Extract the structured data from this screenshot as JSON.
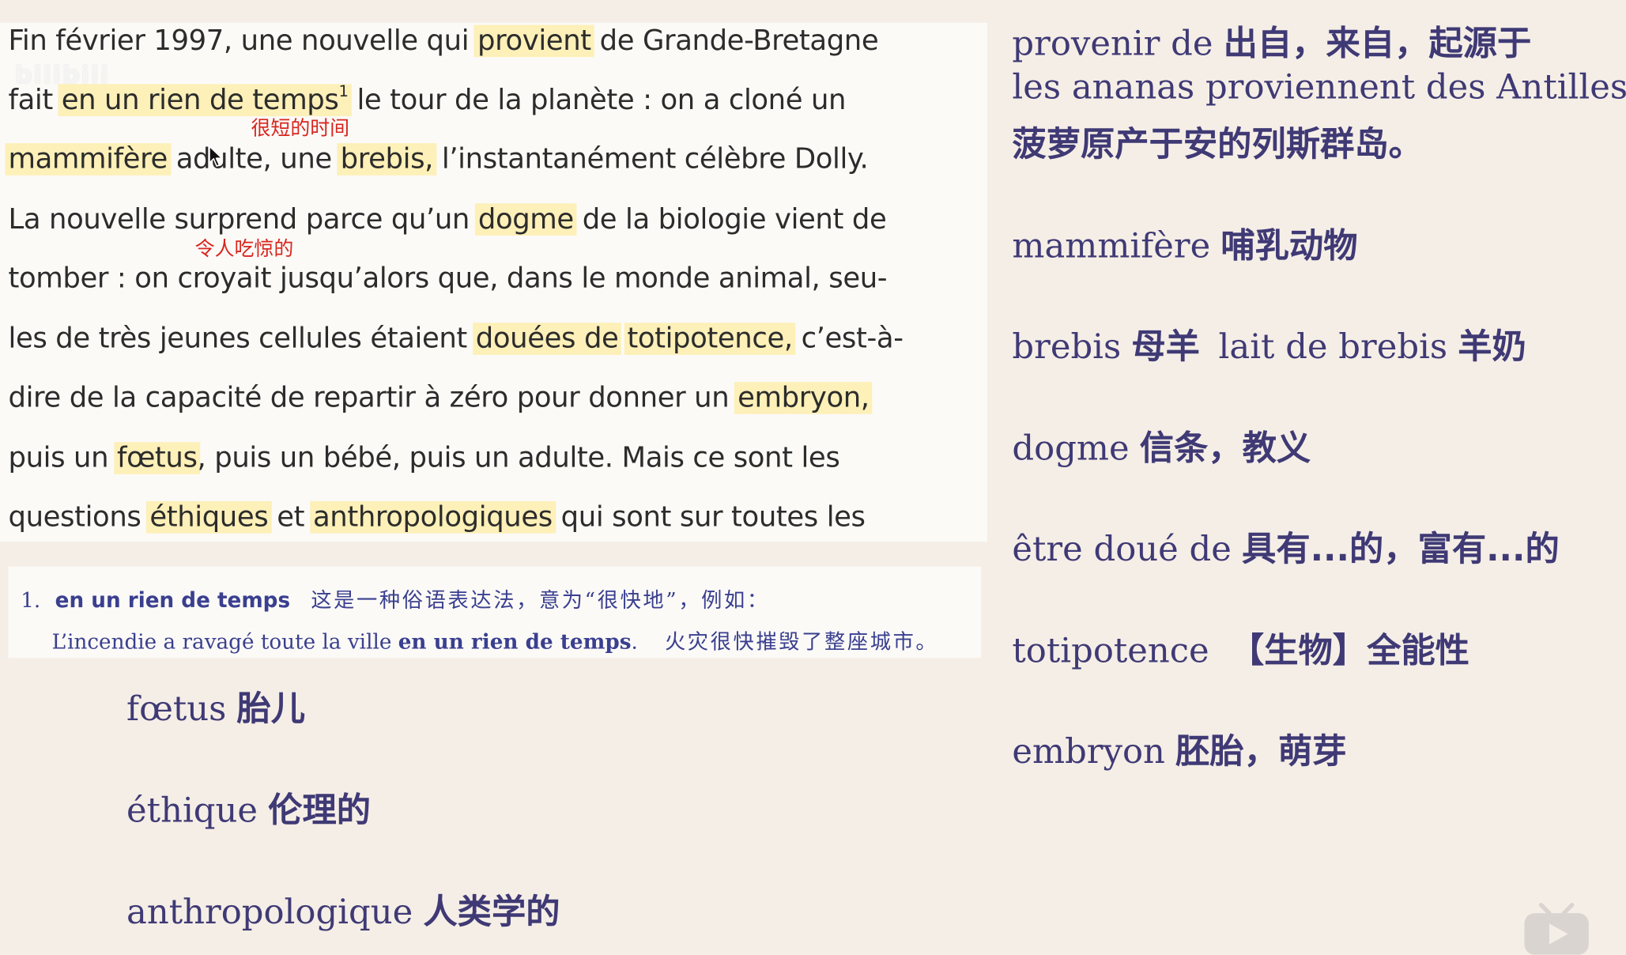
{
  "passage": {
    "lines": [
      {
        "t1": "Fin février 1997, une nouvelle qui ",
        "h1": "provient",
        "t2": " de Grande-Bretagne"
      },
      {
        "t1": "fait ",
        "h1": "en un rien de temps",
        "sup": "1",
        "t2": " le tour de la planète : on a cloné un"
      },
      {
        "h1": "mammifère",
        "t2": " adulte, une ",
        "h2": "brebis,",
        "t3": " l’instantanément célèbre Dolly."
      },
      {
        "t1": "La nouvelle surprend parce qu’un ",
        "h1": "dogme",
        "t2": " de la biologie vient de"
      },
      {
        "t1": "tomber : on croyait jusqu’alors que, dans le monde animal, seu-"
      },
      {
        "t1": "les de très jeunes cellules étaient ",
        "h1": "douées de",
        "t2": " ",
        "h2": "totipotence,",
        "t3": " c’est-à-"
      },
      {
        "t1": "dire de la capacité de repartir à zéro pour donner un ",
        "h1": "embryon,"
      },
      {
        "t1": "puis un ",
        "h1": "fœtus",
        "t2": ", puis un bébé, puis un adulte. Mais ce sont les"
      },
      {
        "t1": "questions ",
        "h1": "éthiques",
        "t2": " et ",
        "h2": "anthropologiques",
        "t3": " qui sont sur toutes les"
      }
    ],
    "annotations": {
      "rien_de_temps": "很短的时间",
      "surprend": "令人吃惊的"
    },
    "watermark": "bilibili"
  },
  "footnote": {
    "number": "1.",
    "term": "en un rien de temps",
    "explanation": "这是一种俗语表达法，意为“很快地”，例如：",
    "example_pre": "L’incendie a ravagé toute la ville ",
    "example_bold": "en un rien de temps",
    "example_post": ".",
    "example_cn": "火灾很快摧毁了整座城市。"
  },
  "vocab_left": [
    {
      "fr": "fœtus",
      "cn": "胎儿"
    },
    {
      "fr": "éthique",
      "cn": "伦理的"
    },
    {
      "fr": "anthropologique",
      "cn": "人类学的"
    }
  ],
  "vocab_right": {
    "provenir": {
      "fr": "provenir de",
      "cn": "出自，来自，起源于"
    },
    "ananas_fr": "les ananas proviennent des Antilles.",
    "ananas_cn": "菠萝原产于安的列斯群岛。",
    "mammifere": {
      "fr": "mammifère",
      "cn": "哺乳动物"
    },
    "brebis": {
      "fr": "brebis",
      "cn": "母羊",
      "fr2": "lait de brebis",
      "cn2": "羊奶"
    },
    "dogme": {
      "fr": "dogme",
      "cn": "信条，教义"
    },
    "doue": {
      "fr": "être doué de",
      "cn": "具有...的，富有...的"
    },
    "totipotence": {
      "fr": "totipotence",
      "cn": "【生物】全能性"
    },
    "embryon": {
      "fr": "embryon",
      "cn": "胚胎，萌芽"
    }
  },
  "colors": {
    "background": "#f5eee6",
    "passage_bg": "#fbfaf7",
    "highlight": "#fdf0b8",
    "annotation_red": "#d8261e",
    "vocab_text": "#3f3a75",
    "footnote_text": "#3a3f8f"
  },
  "icons": {
    "cursor": "mouse-cursor-icon",
    "logo": "bilibili-tv-icon"
  }
}
